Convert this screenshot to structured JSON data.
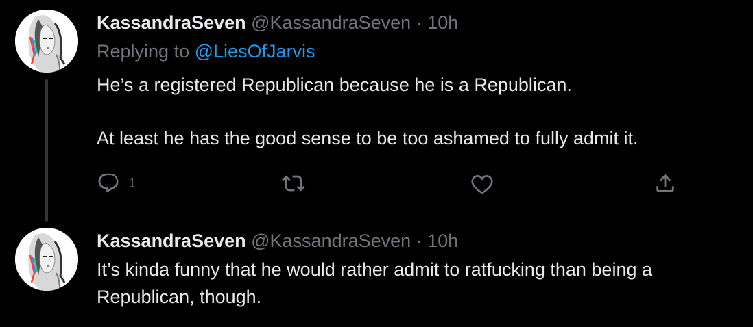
{
  "tweets": [
    {
      "display_name": "KassandraSeven",
      "handle": "@KassandraSeven",
      "separator": "·",
      "time": "10h",
      "replying_prefix": "Replying to",
      "replying_to": "@LiesOfJarvis",
      "text_lines": [
        "He’s a registered Republican because he is a Republican.",
        "At least he has the good sense to be too ashamed to fully admit it."
      ],
      "actions": {
        "reply_icon": "reply-icon",
        "reply_count": "1",
        "retweet_icon": "retweet-icon",
        "like_icon": "heart-icon",
        "share_icon": "share-icon"
      }
    },
    {
      "display_name": "KassandraSeven",
      "handle": "@KassandraSeven",
      "separator": "·",
      "time": "10h",
      "text": "It’s kinda funny that he would rather admit to ratfucking than being a\nRepublican, though."
    }
  ],
  "colors": {
    "background": "#000000",
    "primary_text": "#e7e9ea",
    "secondary_text": "#71767b",
    "accent": "#1d9bf0",
    "thread_line": "#333639"
  }
}
